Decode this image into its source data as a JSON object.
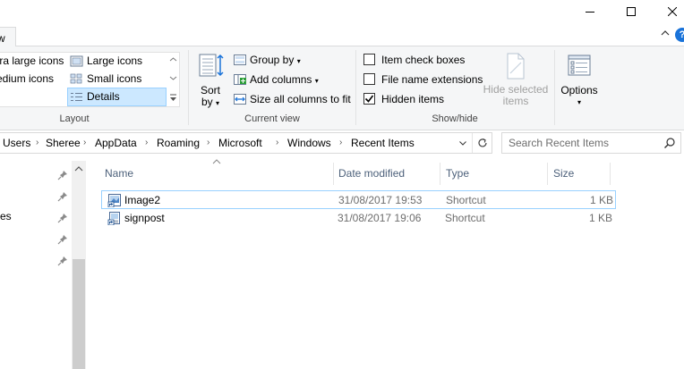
{
  "window": {
    "controls": [
      "minimize",
      "maximize",
      "close"
    ]
  },
  "tabs": {
    "view_label": "w"
  },
  "ribbon": {
    "layout": {
      "items": [
        {
          "label": "tra large icons"
        },
        {
          "label": "Large icons"
        },
        {
          "label": "edium icons"
        },
        {
          "label": "Small icons"
        },
        {
          "label": "t"
        },
        {
          "label": "Details"
        }
      ],
      "group_label": "Layout"
    },
    "current_view": {
      "sort_label_1": "Sort",
      "sort_label_2": "by",
      "group_by": "Group by",
      "add_columns": "Add columns",
      "size_columns": "Size all columns to fit",
      "group_label": "Current view"
    },
    "show_hide": {
      "item_check_boxes": "Item check boxes",
      "file_name_extensions": "File name extensions",
      "hidden_items": "Hidden items",
      "hide_selected_1": "Hide selected",
      "hide_selected_2": "items",
      "group_label": "Show/hide"
    },
    "options": {
      "label": "Options"
    }
  },
  "address": {
    "crumbs": [
      "Users",
      "Sheree",
      "AppData",
      "Roaming",
      "Microsoft",
      "Windows",
      "Recent Items"
    ]
  },
  "search": {
    "placeholder": "Search Recent Items"
  },
  "nav": {
    "partial_label": "es"
  },
  "columns": {
    "name": "Name",
    "date": "Date modified",
    "type": "Type",
    "size": "Size"
  },
  "files": [
    {
      "name": "Image2",
      "date": "31/08/2017 19:53",
      "type": "Shortcut",
      "size": "1 KB"
    },
    {
      "name": "signpost",
      "date": "31/08/2017 19:06",
      "type": "Shortcut",
      "size": "1 KB"
    }
  ],
  "colors": {
    "selection": "#cce8ff",
    "selection_border": "#99d1ff",
    "header_text": "#4c607a",
    "accent": "#1a73d9"
  }
}
